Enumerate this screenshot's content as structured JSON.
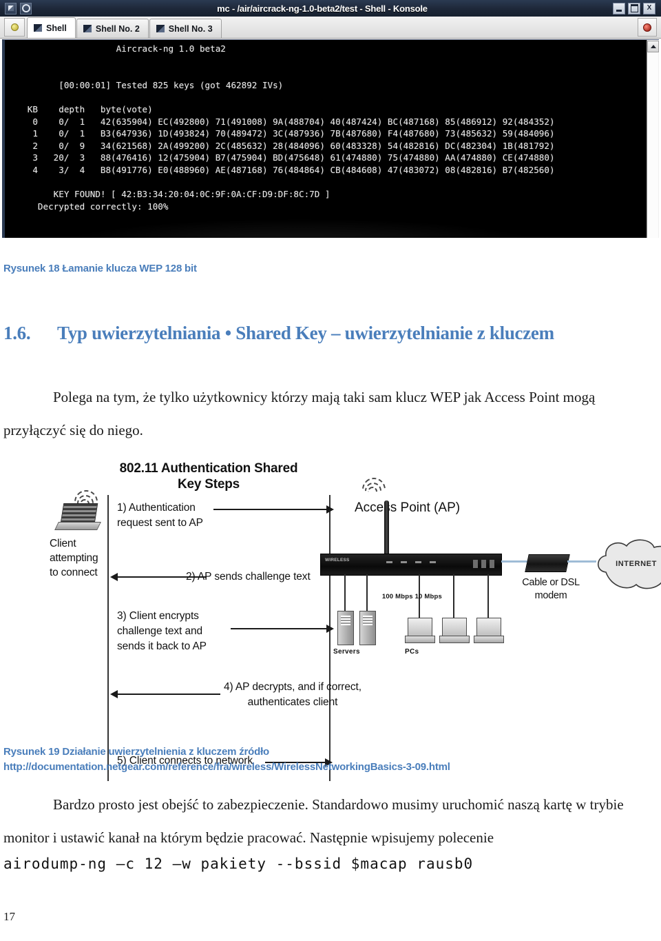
{
  "konsole": {
    "window_title": "mc - /air/aircrack-ng-1.0-beta2/test - Shell - Konsole",
    "window_buttons": {
      "minimize": "_",
      "maximize": "□",
      "close": "X"
    },
    "tabs": [
      {
        "label": "Shell",
        "active": true
      },
      {
        "label": "Shell No. 2",
        "active": false
      },
      {
        "label": "Shell No. 3",
        "active": false
      }
    ],
    "terminal_output": "                    Aircrack-ng 1.0 beta2\n\n\n         [00:00:01] Tested 825 keys (got 462892 IVs)\n\n   KB    depth   byte(vote)\n    0    0/  1   42(635904) EC(492800) 71(491008) 9A(488704) 40(487424) BC(487168) 85(486912) 92(484352)\n    1    0/  1   B3(647936) 1D(493824) 70(489472) 3C(487936) 7B(487680) F4(487680) 73(485632) 59(484096)\n    2    0/  9   34(621568) 2A(499200) 2C(485632) 28(484096) 60(483328) 54(482816) DC(482304) 1B(481792)\n    3   20/  3   88(476416) 12(475904) B7(475904) BD(475648) 61(474880) 75(474880) AA(474880) CE(474880)\n    4    3/  4   B8(491776) E0(488960) AE(487168) 76(484864) CB(484608) 47(483072) 08(482816) B7(482560)\n\n        KEY FOUND! [ 42:B3:34:20:04:0C:9F:0A:CF:D9:DF:8C:7D ]\n     Decrypted correctly: 100%"
  },
  "document": {
    "figure18_caption": "Rysunek 18 Łamanie klucza WEP 128 bit",
    "section_number": "1.6.",
    "section_title": "Typ uwierzytelniania • Shared Key – uwierzytelnianie z kluczem",
    "paragraph1": "Polega na tym, że tylko użytkownicy którzy mają taki sam klucz WEP jak Access Point mogą przyłączyć się do niego.",
    "figure19_caption_line1": "Rysunek 19 Działanie uwierzytelnienia z kluczem źródło",
    "figure19_caption_line2": "http://documentation.netgear.com/reference/fra/wireless/WirelessNetworkingBasics-3-09.html",
    "paragraph2": "Bardzo prosto jest obejść to zabezpieczenie. Standardowo musimy uruchomić naszą kartę w trybie monitor i ustawić kanał na którym będzie pracować. Następnie wpisujemy polecenie",
    "command": "airodump-ng –c 12 –w pakiety --bssid $macap rausb0",
    "page_number": "17"
  },
  "diagram": {
    "title": "802.11 Authentication\nShared Key Steps",
    "client_label": "Client\nattempting\nto connect",
    "ap_label": "Access Point (AP)",
    "steps": [
      "1) Authentication\n    request sent to AP",
      "2) AP sends challenge text",
      "3) Client encrypts\n    challenge text and\n    sends it back to AP",
      "4) AP decrypts, and if correct,\nauthenticates client",
      "5) Client connects to network"
    ],
    "modem_label": "Cable or\nDSL modem",
    "internet_label": "INTERNET",
    "servers_label": "Servers",
    "pcs_label": "PCs",
    "speeds": "100 Mbps\n10 Mbps",
    "ap_device_text": "WIRELESS"
  },
  "colors": {
    "accent_blue": "#4a7ebb",
    "titlebar": "#1d2738",
    "terminal_bg": "#000000",
    "terminal_fg": "#e8e8e8"
  }
}
